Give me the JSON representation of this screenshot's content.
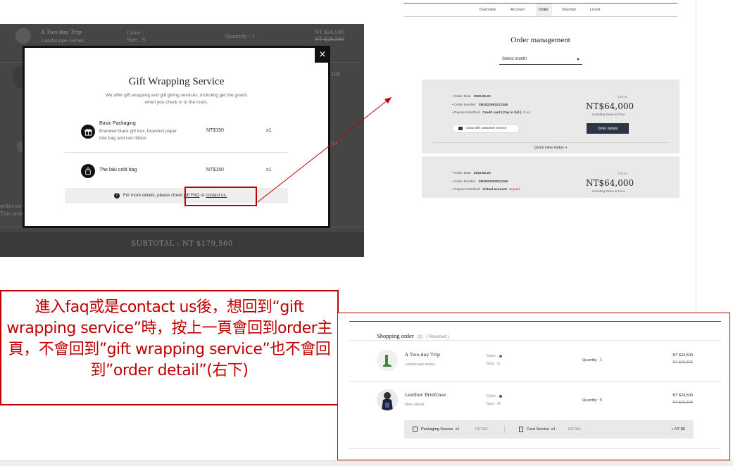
{
  "left_shot": {
    "bg_product_name": "A Two-day Trip",
    "bg_product_series": "Landscape series",
    "bg_color_label": "Color :",
    "bg_size_label": "Size : S",
    "bg_quantity": "Quantity : 1",
    "bg_price": "NT $24,500",
    "bg_price_orig": "NT $29,500",
    "bg_price2": "100",
    "bg_price3": "00",
    "bg_order_note": "order no",
    "bg_order_note2": "This orde",
    "subtotal": "SUBTOTAL : NT $179,560",
    "modal": {
      "title": "Gift Wrapping Service",
      "intro_line1": "We offer gift wrapping and gift giving services, including get the goods",
      "intro_line2": "when you check in to the room.",
      "items": [
        {
          "title": "Basic Packaging",
          "desc_line1": "Branded black gift box, branded paper",
          "desc_line2": "tote bag and red ribbon",
          "price": "NT$150",
          "qty": "x1",
          "icon": "gift-box-icon"
        },
        {
          "title": "The lalu cold bag",
          "price": "NT$150",
          "qty": "x1",
          "icon": "bag-icon"
        }
      ],
      "faq_prefix": "For more details, please check",
      "faq_link": "gift FAQ",
      "faq_or": "or",
      "contact_link": "contact us.",
      "close_glyph": "×"
    }
  },
  "top_right": {
    "nav": [
      "Overview",
      "Account",
      "Order",
      "Voucher",
      "Lovist"
    ],
    "nav_active": "Order",
    "title": "Order management",
    "month_select": "Select month",
    "cards": [
      {
        "order_date_label": "Order Date",
        "order_date": "2022.05.20",
        "order_number_label": "Order Number",
        "order_number": "SN2022052012345",
        "payment_label": "Payment Method",
        "payment": "Credit card ( Pay in full )",
        "status": "Paid",
        "status_color": "#2e9e3e",
        "total_label": "TOTAL",
        "amount": "NT$64,000",
        "incl": "Including Taxes & Fees",
        "chat_button": "Chat with customer service",
        "details_button": "Order details",
        "quick_view": "Quick view status +"
      },
      {
        "order_date_label": "Order Date",
        "order_date": "2022.05.20",
        "order_number_label": "Order Number",
        "order_number": "SN2022052012345",
        "payment_label": "Payment Method",
        "payment": "Virtual account",
        "status": "Unpaid",
        "status_color": "#d0302a",
        "total_label": "TOTAL",
        "amount": "NT$64,000",
        "incl": "Including Taxes & Fees"
      }
    ]
  },
  "annotation": {
    "text": "進入faq或是contact us後，想回到“gift wrapping service”時，按上一頁會回到order主頁，不會回到”gift wrapping service”也不會回到”order detail”(右下)"
  },
  "bottom_right": {
    "section_title": "Shopping order",
    "section_count": "(3)",
    "section_returned": "( Returned )",
    "items": [
      {
        "name": "A Two-day Trip",
        "series": "Landscape series",
        "color_label": "Color :",
        "color_dot": "#3a9a3a",
        "size": "Size : S",
        "quantity": "Quantity : 1",
        "price": "NT $24,500",
        "orig": "NT $29,500"
      },
      {
        "name": "Leather Briefcase",
        "series": "New arrival",
        "color_label": "Color :",
        "color_dot": "#3a5aa0",
        "size": "Size : M",
        "quantity": "Quantity : 5",
        "price": "NT $24,500",
        "orig": "NT $29,500"
      }
    ],
    "packaging_label": "Packaging Service",
    "packaging_qty": "x1",
    "packaging_detail": "DETAIL",
    "card_label": "Card Service",
    "card_qty": "x1",
    "card_detail": "DETAIL",
    "services_total": "+ NT $0"
  },
  "colors": {
    "accent_red": "#c00000",
    "dark_button": "#2b3544"
  }
}
